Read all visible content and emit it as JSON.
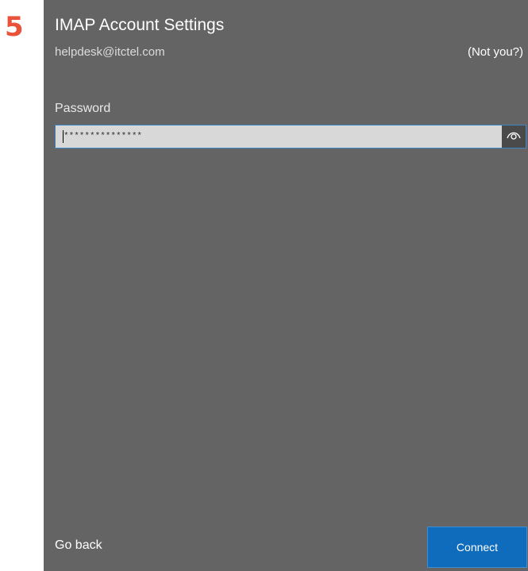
{
  "step": {
    "number": "5"
  },
  "dialog": {
    "title": "IMAP Account Settings",
    "email": "helpdesk@itctel.com",
    "not_you_label": "(Not you?)",
    "password_label": "Password",
    "password_value": "***************",
    "reveal_icon": "eye-icon",
    "go_back_label": "Go back",
    "connect_label": "Connect"
  },
  "colors": {
    "panel_background": "#646464",
    "step_number": "#e8533a",
    "accent": "#0f6cbd",
    "input_border": "#3d85c6"
  }
}
